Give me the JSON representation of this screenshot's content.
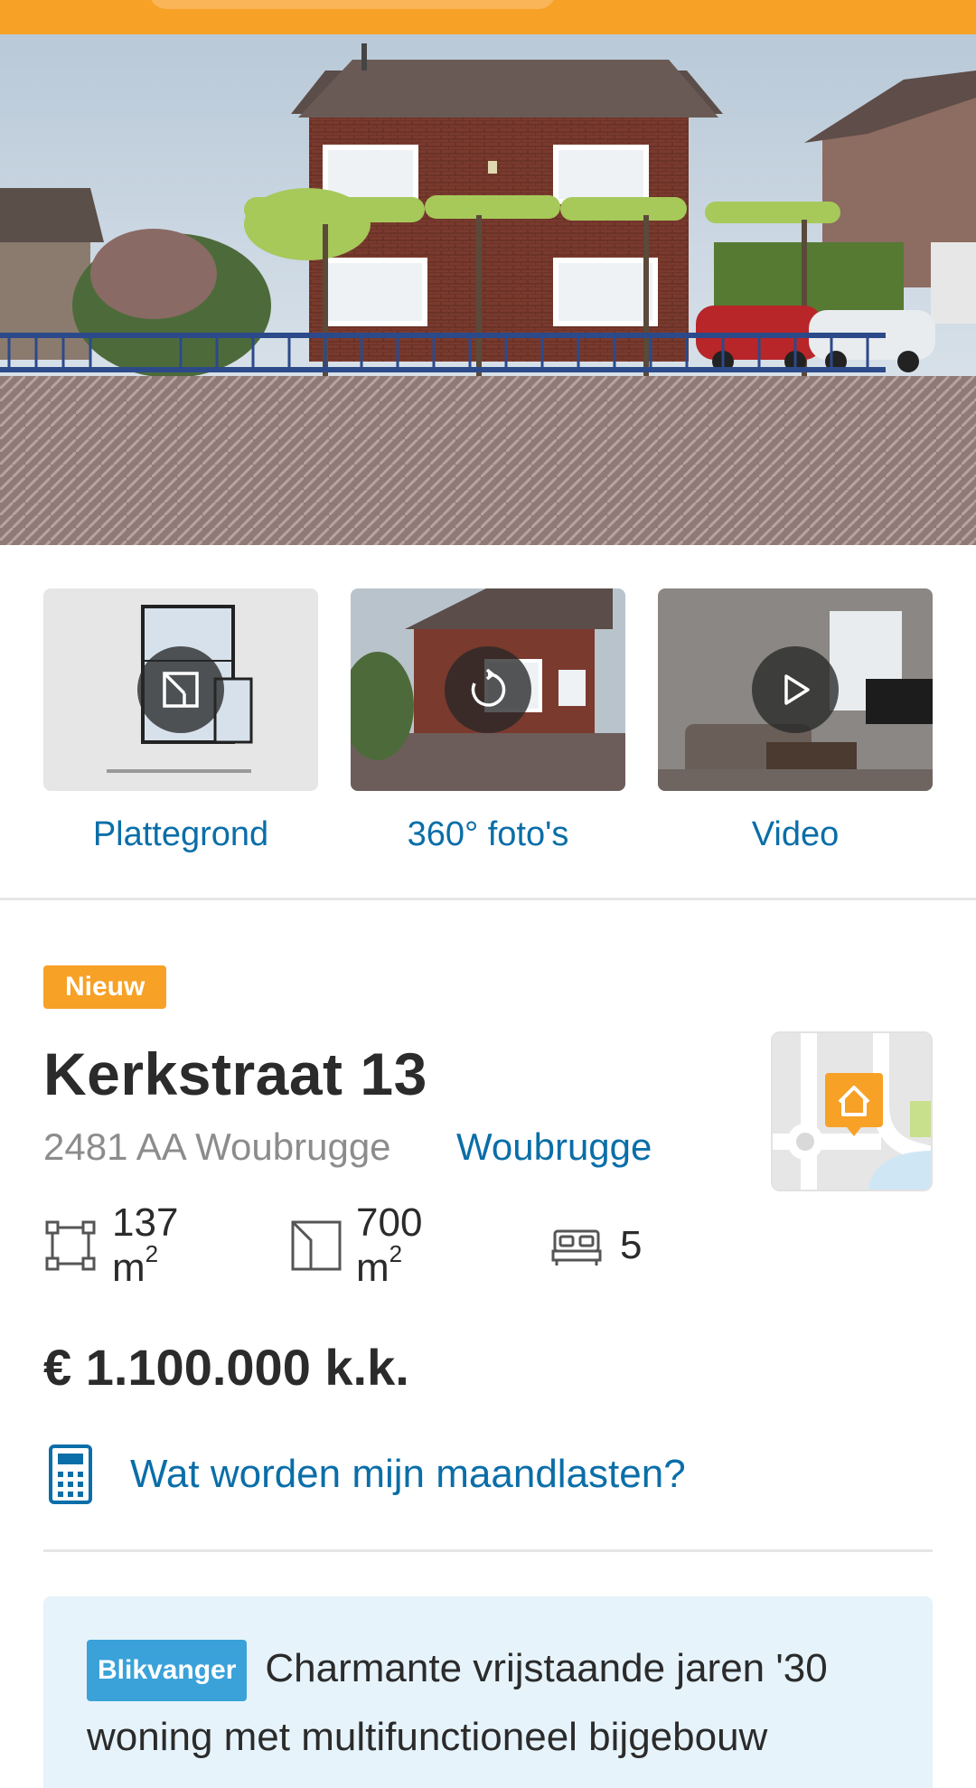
{
  "media": {
    "floorplan_label": "Plattegrond",
    "photos360_label": "360° foto's",
    "video_label": "Video"
  },
  "listing": {
    "badge": "Nieuw",
    "title": "Kerkstraat 13",
    "postal": "2481 AA Woubrugge",
    "city_link": "Woubrugge",
    "living_area": "137 m",
    "living_area_unit_sup": "2",
    "plot_area": "700 m",
    "plot_area_unit_sup": "2",
    "bedrooms": "5",
    "price": "€ 1.100.000 k.k.",
    "mortgage_link": "Wat worden mijn maandlasten?"
  },
  "highlight": {
    "badge": "Blikvanger",
    "text": "Charmante vrijstaande jaren '30 woning met multifunctioneel bijgebouw"
  },
  "colors": {
    "brand_orange": "#f7a126",
    "link_blue": "#0a6ea8",
    "highlight_bg": "#e6f3fb",
    "badge_blue": "#3aa2d9"
  },
  "icons": [
    "floorplan-icon",
    "rotate-360-icon",
    "play-icon",
    "map-house-pin-icon",
    "living-area-icon",
    "plot-area-icon",
    "bed-icon",
    "calculator-icon"
  ]
}
